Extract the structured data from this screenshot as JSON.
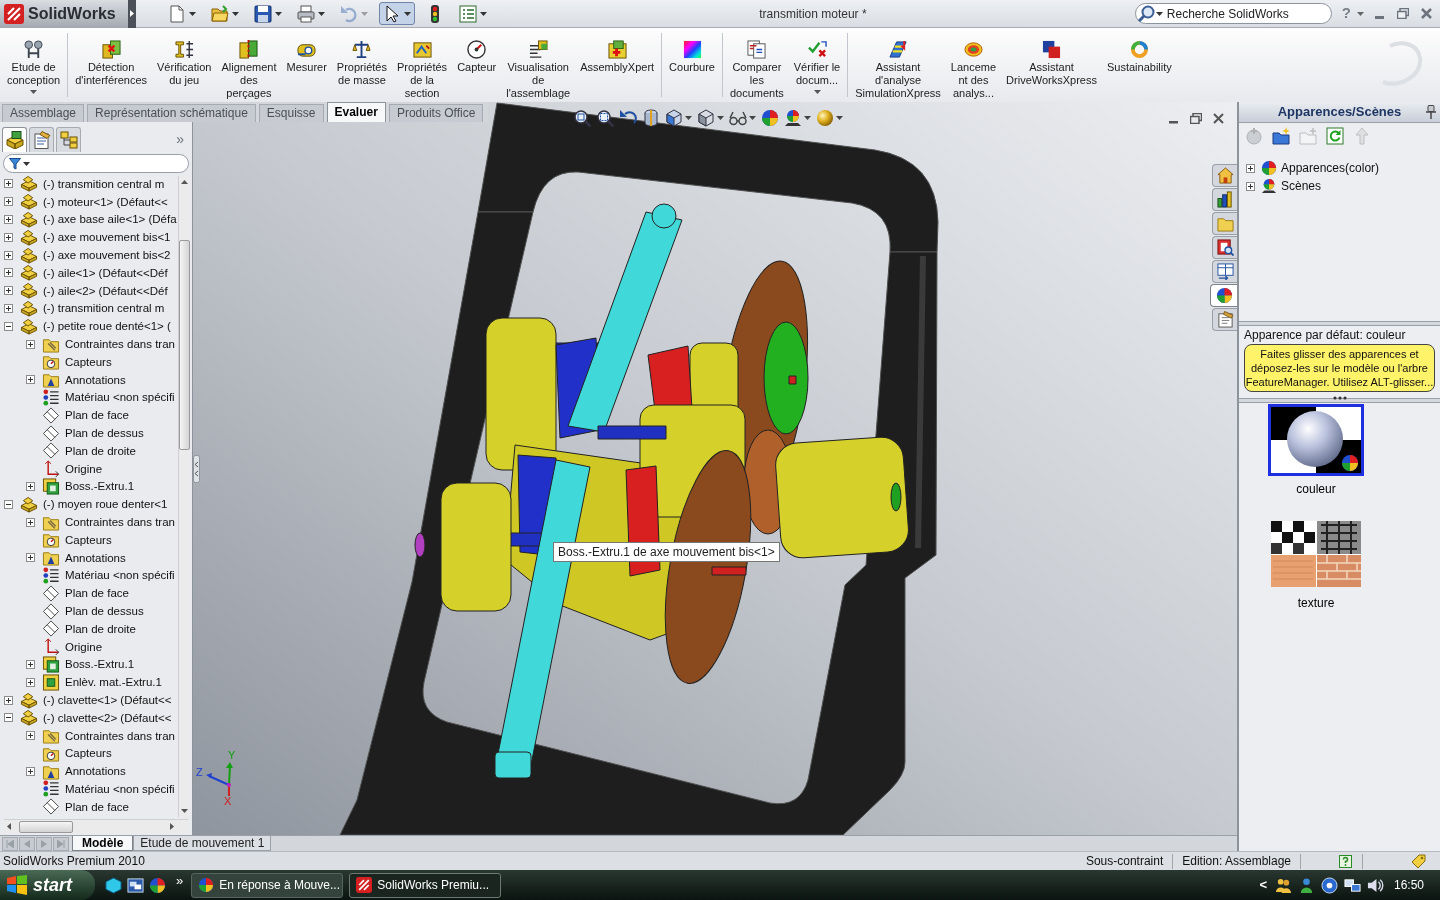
{
  "title_bar": {
    "app_name": "SolidWorks",
    "document_title": "transmition moteur *",
    "search": {
      "placeholder": "Recherche SolidWorks"
    },
    "help": "?",
    "quick_access": [
      {
        "kind": "new",
        "dropdown": true,
        "disabled": false,
        "selected": false
      },
      {
        "kind": "open",
        "dropdown": true,
        "disabled": false,
        "selected": false
      },
      {
        "kind": "save",
        "dropdown": true,
        "disabled": false,
        "selected": false
      },
      {
        "kind": "print",
        "dropdown": true,
        "disabled": false,
        "selected": false
      },
      {
        "kind": "undo",
        "dropdown": true,
        "disabled": true,
        "selected": false
      },
      {
        "kind": "select",
        "dropdown": true,
        "disabled": false,
        "selected": true
      },
      {
        "kind": "rebuild",
        "dropdown": false,
        "disabled": false,
        "selected": false
      },
      {
        "kind": "options",
        "dropdown": true,
        "disabled": false,
        "selected": false
      }
    ]
  },
  "ribbon": {
    "groups": [
      {
        "commands": [
          {
            "kind": "design-study",
            "label": "Etude de\nconception",
            "dropdown": true
          }
        ]
      },
      {
        "commands": [
          {
            "kind": "interference",
            "label": "Détection\nd'interférences",
            "dropdown": false
          },
          {
            "kind": "clearance",
            "label": "Vérification\ndu jeu",
            "dropdown": false
          },
          {
            "kind": "hole-alignment",
            "label": "Alignement\ndes\nperçages",
            "dropdown": false
          },
          {
            "kind": "measure",
            "label": "Mesurer",
            "dropdown": false
          },
          {
            "kind": "mass-properties",
            "label": "Propriétés\nde masse",
            "dropdown": false
          },
          {
            "kind": "section-properties",
            "label": "Propriétés\nde la\nsection",
            "dropdown": false
          },
          {
            "kind": "sensor",
            "label": "Capteur",
            "dropdown": false
          },
          {
            "kind": "assembly-visualization",
            "label": "Visualisation\nde\nl'assemblage",
            "dropdown": false
          },
          {
            "kind": "assemblyxpert",
            "label": "AssemblyXpert",
            "dropdown": false
          }
        ]
      },
      {
        "commands": [
          {
            "kind": "curvature",
            "label": "Courbure",
            "dropdown": false
          }
        ]
      },
      {
        "commands": [
          {
            "kind": "compare",
            "label": "Comparer\nles\ndocuments",
            "dropdown": false
          },
          {
            "kind": "check",
            "label": "Vérifier le\ndocum...",
            "dropdown": true
          }
        ]
      },
      {
        "commands": [
          {
            "kind": "simulation",
            "label": "Assistant\nd'analyse\nSimulationXpress",
            "dropdown": false
          },
          {
            "kind": "analysis-launch",
            "label": "Lanceme\nnt des\nanalys...",
            "dropdown": false
          },
          {
            "kind": "driveworks",
            "label": "Assistant\nDriveWorksXpress",
            "dropdown": false
          },
          {
            "kind": "sustainability",
            "label": "Sustainability",
            "dropdown": false
          }
        ]
      }
    ]
  },
  "command_tabs": [
    {
      "label": "Assemblage",
      "selected": false
    },
    {
      "label": "Représentation schématique",
      "selected": false
    },
    {
      "label": "Esquisse",
      "selected": false
    },
    {
      "label": "Evaluer",
      "selected": true
    },
    {
      "label": "Produits Office",
      "selected": false
    }
  ],
  "feature_manager": {
    "tabs": [
      {
        "kind": "features",
        "selected": true
      },
      {
        "kind": "properties",
        "selected": false
      },
      {
        "kind": "configurations",
        "selected": false
      }
    ],
    "collapse": "»",
    "tree": [
      {
        "label": "(-) transmition central m",
        "kind": "component",
        "expanded": false
      },
      {
        "label": "(-) moteur<1> (Défaut<<",
        "kind": "component",
        "expanded": false
      },
      {
        "label": "(-) axe base aile<1> (Défa",
        "kind": "component",
        "expanded": false
      },
      {
        "label": "(-) axe mouvement bis<1",
        "kind": "component",
        "expanded": false
      },
      {
        "label": "(-) axe mouvement bis<2",
        "kind": "component",
        "expanded": false
      },
      {
        "label": "(-) aile<1> (Défaut<<Déf",
        "kind": "component",
        "expanded": false
      },
      {
        "label": "(-) aile<2> (Défaut<<Déf",
        "kind": "component",
        "expanded": false
      },
      {
        "label": "(-) transmition central m",
        "kind": "component",
        "expanded": false
      },
      {
        "label": "(-) petite roue denté<1> (",
        "kind": "component",
        "expanded": true,
        "children": [
          {
            "label": "Contraintes dans tran",
            "kind": "mates",
            "expanded": false
          },
          {
            "label": "Capteurs",
            "kind": "sensors"
          },
          {
            "label": "Annotations",
            "kind": "annotations",
            "expanded": false
          },
          {
            "label": "Matériau <non spécifi",
            "kind": "material"
          },
          {
            "label": "Plan de face",
            "kind": "plane"
          },
          {
            "label": "Plan de dessus",
            "kind": "plane"
          },
          {
            "label": "Plan de droite",
            "kind": "plane"
          },
          {
            "label": "Origine",
            "kind": "origin"
          },
          {
            "label": "Boss.-Extru.1",
            "kind": "boss",
            "expanded": false
          }
        ]
      },
      {
        "label": "(-) moyen roue denter<1",
        "kind": "component",
        "expanded": true,
        "children": [
          {
            "label": "Contraintes dans tran",
            "kind": "mates",
            "expanded": false
          },
          {
            "label": "Capteurs",
            "kind": "sensors"
          },
          {
            "label": "Annotations",
            "kind": "annotations",
            "expanded": false
          },
          {
            "label": "Matériau <non spécifi",
            "kind": "material"
          },
          {
            "label": "Plan de face",
            "kind": "plane"
          },
          {
            "label": "Plan de dessus",
            "kind": "plane"
          },
          {
            "label": "Plan de droite",
            "kind": "plane"
          },
          {
            "label": "Origine",
            "kind": "origin"
          },
          {
            "label": "Boss.-Extru.1",
            "kind": "boss",
            "expanded": false
          },
          {
            "label": "Enlèv. mat.-Extru.1",
            "kind": "cut",
            "expanded": false
          }
        ]
      },
      {
        "label": "(-) clavette<1> (Défaut<<",
        "kind": "component",
        "expanded": false
      },
      {
        "label": "(-) clavette<2> (Défaut<<",
        "kind": "component",
        "expanded": true,
        "children": [
          {
            "label": "Contraintes dans tran",
            "kind": "mates",
            "expanded": false
          },
          {
            "label": "Capteurs",
            "kind": "sensors"
          },
          {
            "label": "Annotations",
            "kind": "annotations",
            "expanded": false
          },
          {
            "label": "Matériau <non spécifi",
            "kind": "material"
          },
          {
            "label": "Plan de face",
            "kind": "plane"
          }
        ]
      }
    ]
  },
  "viewport": {
    "heads_up": [
      {
        "kind": "zoom-fit",
        "dropdown": false
      },
      {
        "kind": "zoom-area",
        "dropdown": false
      },
      {
        "kind": "previous-view",
        "dropdown": false
      },
      {
        "kind": "section-view",
        "dropdown": false
      },
      {
        "kind": "view-orientation",
        "dropdown": true
      },
      {
        "kind": "display-style",
        "dropdown": true
      },
      {
        "kind": "hide-show",
        "dropdown": true
      },
      {
        "kind": "edit-appearance",
        "dropdown": false
      },
      {
        "kind": "apply-scene",
        "dropdown": true
      },
      {
        "kind": "view-settings",
        "dropdown": true
      }
    ],
    "tooltip": "Boss.-Extru.1 de axe mouvement bis<1>",
    "triad": [
      {
        "kind": "y",
        "label": "Y"
      },
      {
        "kind": "z",
        "label": "Z"
      },
      {
        "kind": "x",
        "label": "X"
      }
    ]
  },
  "bottom_tabs": [
    {
      "label": "Modèle",
      "selected": true
    },
    {
      "label": "Etude de mouvement 1",
      "selected": false
    }
  ],
  "task_pane": {
    "tabs": [
      {
        "kind": "home",
        "selected": false
      },
      {
        "kind": "design-library",
        "selected": false
      },
      {
        "kind": "file-explorer",
        "selected": false
      },
      {
        "kind": "search",
        "selected": false
      },
      {
        "kind": "view-palette",
        "selected": false
      },
      {
        "kind": "appearances",
        "selected": true
      },
      {
        "kind": "custom-properties",
        "selected": false
      }
    ],
    "title": "Apparences/Scènes",
    "toolbar": [
      {
        "kind": "add-appearance",
        "disabled": true
      },
      {
        "kind": "new-folder",
        "disabled": false
      },
      {
        "kind": "add-folder",
        "disabled": true
      },
      {
        "kind": "refresh",
        "disabled": false
      },
      {
        "kind": "move-up",
        "disabled": true
      }
    ],
    "tree": [
      {
        "label": "Apparences(color)",
        "kind": "appearances",
        "expanded": false
      },
      {
        "label": "Scènes",
        "kind": "scenes",
        "expanded": false
      }
    ],
    "default_label": "Apparence par défaut: couleur",
    "hint": "Faites glisser des apparences et\ndéposez-les sur le modèle ou l'arbre\nFeatureManager. Utilisez ALT-glisser...",
    "thumbnails": [
      {
        "label": "couleur",
        "kind": "sphere",
        "selected": true
      },
      {
        "label": "texture",
        "kind": "textures",
        "selected": false
      }
    ]
  },
  "status_bar": {
    "product": "SolidWorks Premium 2010",
    "state": "Sous-contraint",
    "mode": "Edition: Assemblage"
  },
  "taskbar": {
    "start": "start",
    "more": "»",
    "tasks": [
      {
        "label": "En réponse à Mouve...",
        "kind": "browser",
        "selected": false
      },
      {
        "label": "SolidWorks Premiu...",
        "kind": "solidworks",
        "selected": true
      }
    ],
    "tray_expand": "<",
    "clock": "16:50"
  }
}
